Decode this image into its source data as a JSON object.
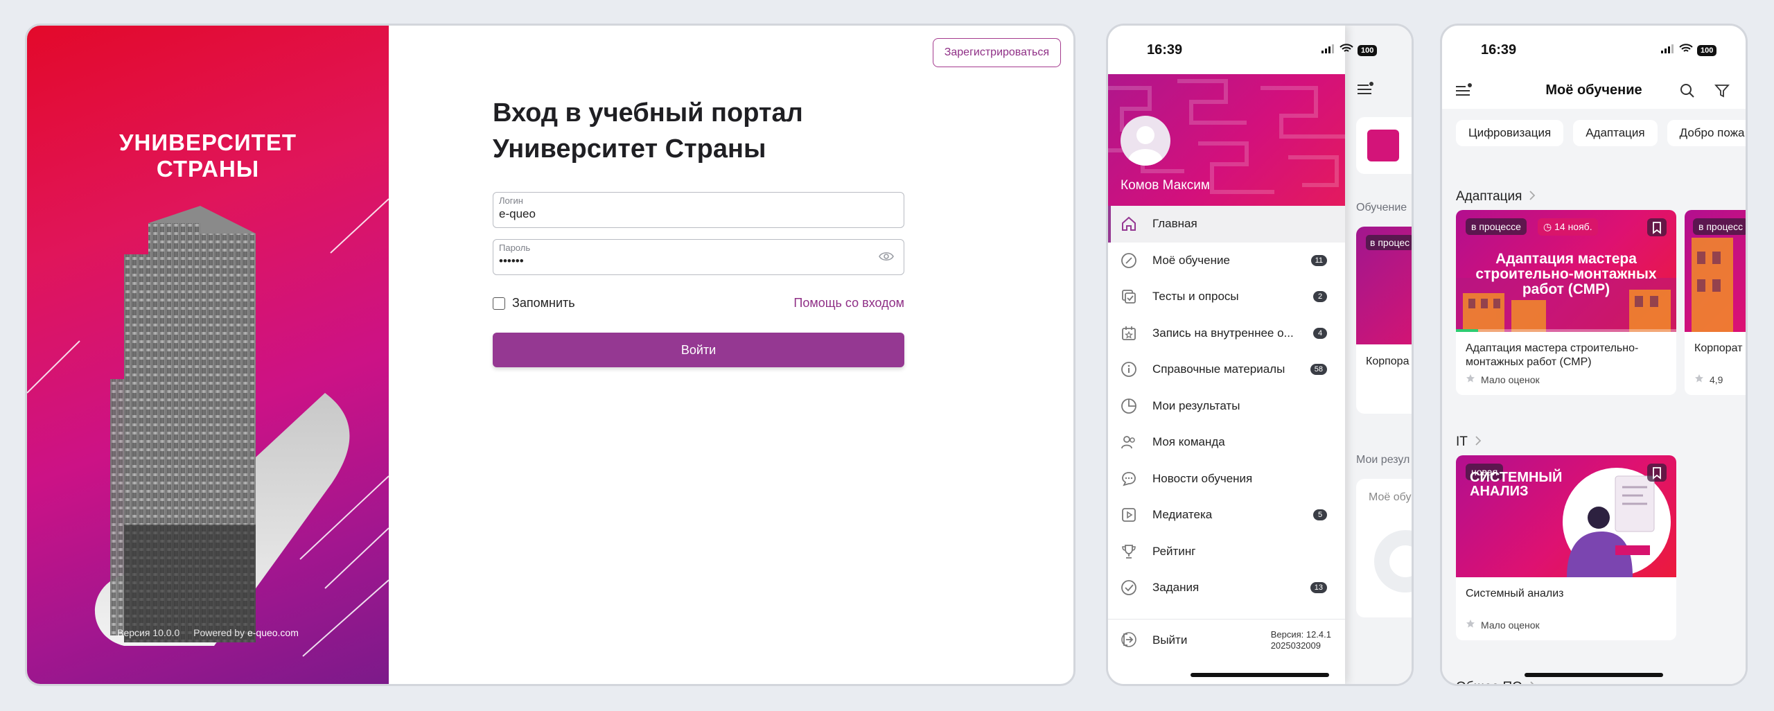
{
  "desktop": {
    "brand_line1": "УНИВЕРСИТЕТ",
    "brand_line2": "СТРАНЫ",
    "version": "Версия 10.0.0",
    "powered_prefix": "Powered by",
    "powered_link": "e-queo.com",
    "register_label": "Зарегистрироваться",
    "title_line1": "Вход в учебный портал",
    "title_line2": "Университет Страны",
    "login_label": "Логин",
    "login_value": "e-queo",
    "password_label": "Пароль",
    "password_value": "••••••",
    "remember_label": "Запомнить",
    "help_label": "Помощь со входом",
    "submit_label": "Войти",
    "accent": "#953892"
  },
  "phone1": {
    "time": "16:39",
    "battery": "100",
    "user_name": "Комов Максим",
    "menu": [
      {
        "label": "Главная",
        "count": ""
      },
      {
        "label": "Моё обучение",
        "count": "11"
      },
      {
        "label": "Тесты и опросы",
        "count": "2"
      },
      {
        "label": "Запись на внутреннее о...",
        "count": "4"
      },
      {
        "label": "Справочные материалы",
        "count": "58"
      },
      {
        "label": "Мои результаты",
        "count": ""
      },
      {
        "label": "Моя команда",
        "count": ""
      },
      {
        "label": "Новости обучения",
        "count": ""
      },
      {
        "label": "Медиатека",
        "count": "5"
      },
      {
        "label": "Рейтинг",
        "count": ""
      },
      {
        "label": "Задания",
        "count": "13"
      }
    ],
    "logout_label": "Выйти",
    "version_line1": "Версия: 12.4.1",
    "version_line2": "2025032009",
    "bg_section1": "Обучение",
    "bg_card_badge": "в процес",
    "bg_card_title": "Корпора",
    "bg_section2": "Мои резул",
    "bg_panel_title": "Моё обу"
  },
  "phone2": {
    "time": "16:39",
    "battery": "100",
    "title": "Моё обучение",
    "chips": [
      "Цифровизация",
      "Адаптация",
      "Добро пожа"
    ],
    "section1": "Адаптация",
    "card1": {
      "badge": "в процессе",
      "date": "14 нояб.",
      "image_text": "Адаптация мастера строительно-монтажных работ (СМР)",
      "title": "Адаптация мастера строительно-монтажных работ (СМР)",
      "rating": "Мало оценок",
      "progress": 0.1
    },
    "card2": {
      "badge": "в процесс",
      "title": "Корпорат",
      "rating": "4,9"
    },
    "section2": "IT",
    "card3": {
      "badge": "новая",
      "image_text": "СИСТЕМНЫЙ АНАЛИЗ",
      "title": "Системный анализ",
      "rating": "Мало оценок"
    },
    "section3": "Общее ПО"
  }
}
